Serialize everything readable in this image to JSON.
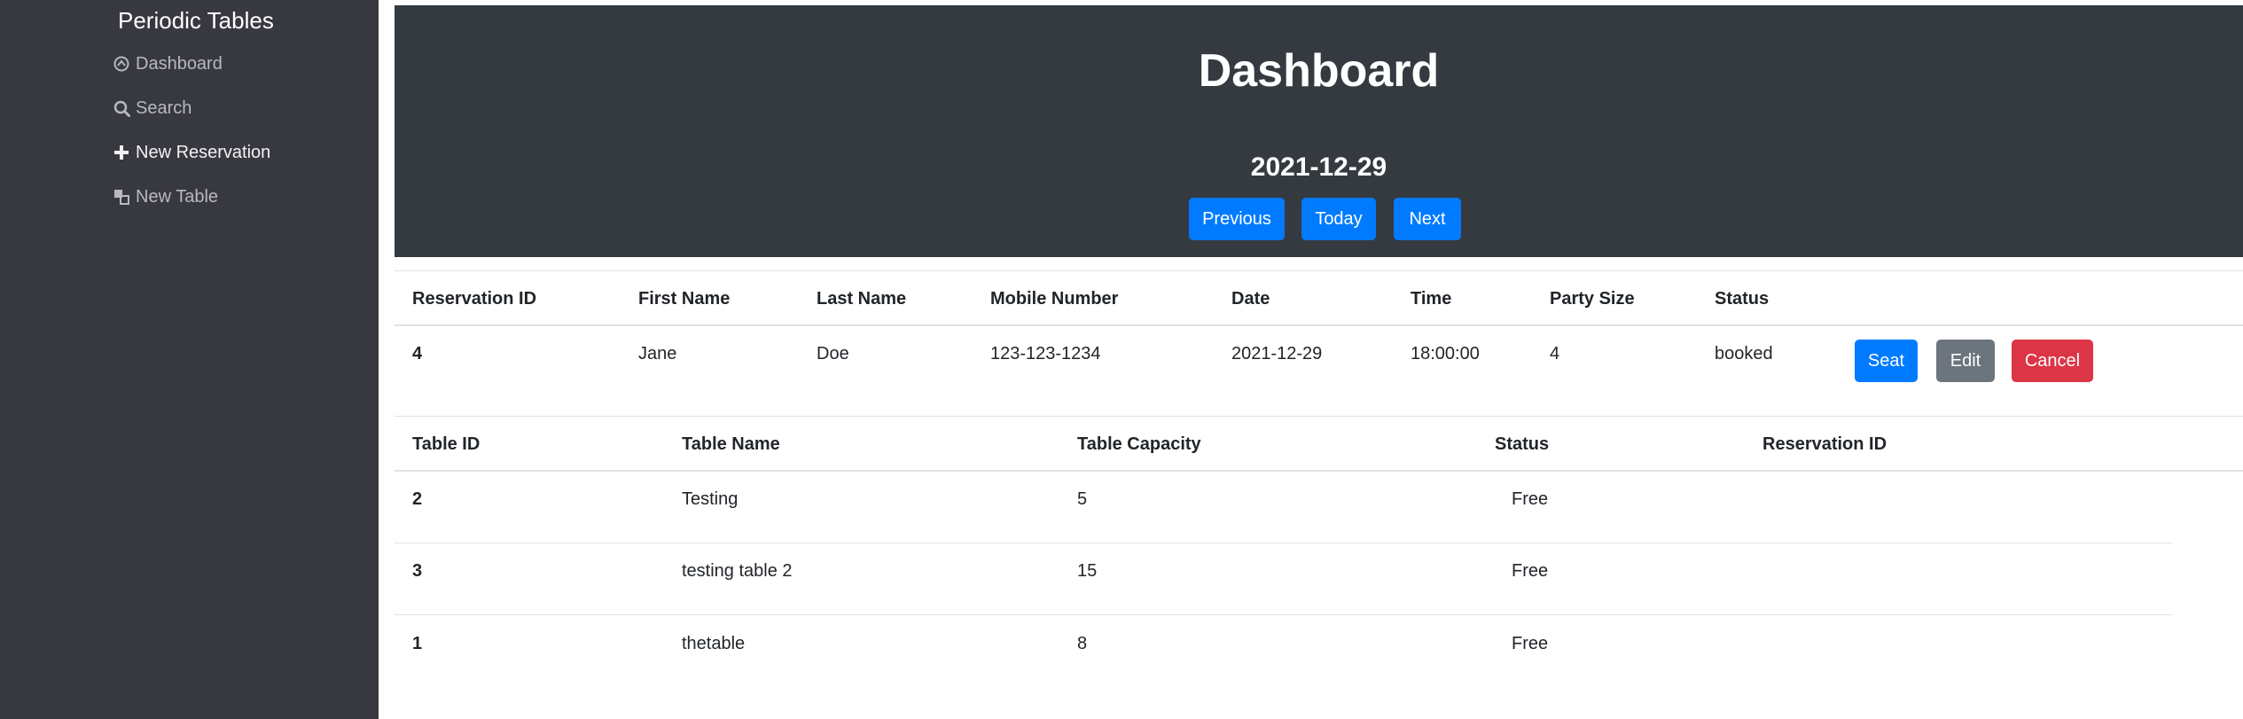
{
  "sidebar": {
    "brand": "Periodic Tables",
    "items": [
      {
        "label": "Dashboard",
        "icon": "dashboard-icon"
      },
      {
        "label": "Search",
        "icon": "search-icon"
      },
      {
        "label": "New Reservation",
        "icon": "plus-icon"
      },
      {
        "label": "New Table",
        "icon": "table-icon"
      }
    ]
  },
  "header": {
    "title": "Dashboard",
    "date": "2021-12-29",
    "previous_label": "Previous",
    "today_label": "Today",
    "next_label": "Next"
  },
  "reservations": {
    "columns": [
      "Reservation ID",
      "First Name",
      "Last Name",
      "Mobile Number",
      "Date",
      "Time",
      "Party Size",
      "Status"
    ],
    "rows": [
      {
        "id": "4",
        "first_name": "Jane",
        "last_name": "Doe",
        "mobile": "123-123-1234",
        "date": "2021-12-29",
        "time": "18:00:00",
        "party_size": "4",
        "status": "booked",
        "seat_label": "Seat",
        "edit_label": "Edit",
        "cancel_label": "Cancel"
      }
    ]
  },
  "tables": {
    "columns": [
      "Table ID",
      "Table Name",
      "Table Capacity",
      "Status",
      "Reservation ID"
    ],
    "rows": [
      {
        "id": "2",
        "name": "Testing",
        "capacity": "5",
        "status": "Free",
        "reservation_id": ""
      },
      {
        "id": "3",
        "name": "testing table 2",
        "capacity": "15",
        "status": "Free",
        "reservation_id": ""
      },
      {
        "id": "1",
        "name": "thetable",
        "capacity": "8",
        "status": "Free",
        "reservation_id": ""
      }
    ]
  },
  "colors": {
    "sidebar_bg": "#383841",
    "header_bg": "#343a40",
    "primary": "#007bff",
    "secondary": "#6c757d",
    "danger": "#dc3545"
  }
}
